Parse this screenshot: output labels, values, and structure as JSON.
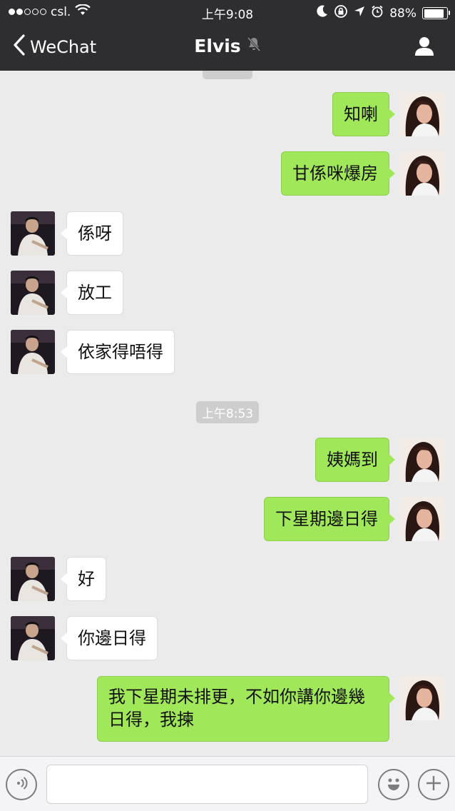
{
  "status_bar": {
    "carrier": "csl.",
    "time": "上午9:08",
    "battery_percent": "88%",
    "battery_level": 0.88
  },
  "nav": {
    "back_label": "WeChat",
    "title": "Elvis",
    "icons": {
      "back": "chevron-left-icon",
      "mute": "mute-bell-icon",
      "profile": "user-icon"
    }
  },
  "chat": {
    "timestamps": [
      "上午8:53"
    ],
    "messages": [
      {
        "side": "out",
        "text": "知喇"
      },
      {
        "side": "out",
        "text": "甘係咪爆房"
      },
      {
        "side": "in",
        "text": "係呀"
      },
      {
        "side": "in",
        "text": "放工"
      },
      {
        "side": "in",
        "text": "依家得唔得"
      },
      {
        "side": "out",
        "text": "姨媽到"
      },
      {
        "side": "out",
        "text": "下星期邊日得"
      },
      {
        "side": "in",
        "text": "好"
      },
      {
        "side": "in",
        "text": "你邊日得"
      },
      {
        "side": "out",
        "text": "我下星期未排更，不如你講你邊幾日得，我揀"
      }
    ]
  },
  "input_bar": {
    "icons": {
      "voice": "voice-icon",
      "emoji": "emoji-icon",
      "more": "plus-icon"
    },
    "value": "",
    "placeholder": ""
  },
  "colors": {
    "nav_bg": "#2e2e31",
    "chat_bg": "#ebebeb",
    "outgoing_bubble": "#a0e75a",
    "incoming_bubble": "#ffffff"
  }
}
